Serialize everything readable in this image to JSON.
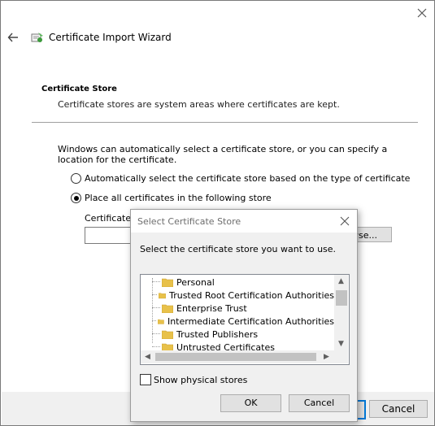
{
  "wizard": {
    "title": "Certificate Import Wizard",
    "section_title": "Certificate Store",
    "section_desc": "Certificate stores are system areas where certificates are kept.",
    "intro": "Windows can automatically select a certificate store, or you can specify a location for the certificate.",
    "radio_auto": "Automatically select the certificate store based on the type of certificate",
    "radio_place": "Place all certificates in the following store",
    "store_label": "Certificate s",
    "store_value": "",
    "browse_label": "wse...",
    "cancel_label": "Cancel",
    "radio_auto_checked": false,
    "radio_place_checked": true
  },
  "dialog": {
    "title": "Select Certificate Store",
    "prompt": "Select the certificate store you want to use.",
    "stores": [
      "Personal",
      "Trusted Root Certification Authorities",
      "Enterprise Trust",
      "Intermediate Certification Authorities",
      "Trusted Publishers",
      "Untrusted Certificates"
    ],
    "show_physical_label": "Show physical stores",
    "show_physical_checked": false,
    "ok_label": "OK",
    "cancel_label": "Cancel"
  },
  "colors": {
    "accent": "#0078d7",
    "folder": "#e8c14a",
    "footer": "#f0f0f0"
  }
}
